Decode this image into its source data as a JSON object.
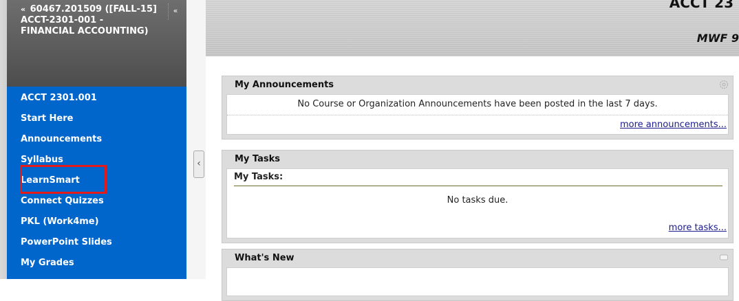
{
  "menu": {
    "header_title": "60467.201509 ([FALL-15] ACCT-2301-001 - FINANCIAL ACCOUNTING)",
    "header_chevron": "«",
    "collapse_glyph": "«",
    "items": [
      {
        "label": "ACCT 2301.001"
      },
      {
        "label": "Start Here"
      },
      {
        "label": "Announcements"
      },
      {
        "label": "Syllabus"
      },
      {
        "label": "LearnSmart"
      },
      {
        "label": "Connect Quizzes"
      },
      {
        "label": "PKL (Work4me)"
      },
      {
        "label": "PowerPoint Slides"
      },
      {
        "label": "My Grades"
      }
    ],
    "highlighted_item": "LearnSmart",
    "highlight_color": "#e21a1a",
    "background_color": "#0066cc"
  },
  "splitter": {
    "glyph": "‹"
  },
  "banner": {
    "course_code": "ACCT 23",
    "schedule": "MWF 9"
  },
  "modules": {
    "announcements": {
      "title": "My Announcements",
      "message": "No Course or Organization Announcements have been posted in the last 7 days.",
      "more_link": "more announcements...",
      "icon": "gear-icon"
    },
    "tasks": {
      "title": "My Tasks",
      "subtitle": "My Tasks:",
      "message": "No tasks due.",
      "more_link": "more tasks..."
    },
    "whats_new": {
      "title": "What's New",
      "icon": "comment-icon"
    }
  }
}
